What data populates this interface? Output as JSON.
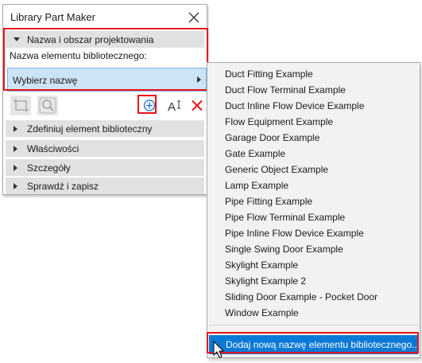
{
  "window": {
    "title": "Library Part Maker"
  },
  "sections": {
    "open": {
      "label": "Nazwa i obszar projektowania"
    },
    "collapsed": [
      {
        "label": "Zdefiniuj element biblioteczny"
      },
      {
        "label": "Właściwości"
      },
      {
        "label": "Szczegóły"
      },
      {
        "label": "Sprawdź i zapisz"
      }
    ]
  },
  "name_field": {
    "label": "Nazwa elementu bibliotecznego:",
    "value": "Wybierz nazwę"
  },
  "toolbar": {
    "buttons": [
      {
        "icon": "crop-frame-icon",
        "enabled": false
      },
      {
        "icon": "zoom-icon",
        "enabled": false
      },
      {
        "icon": "add-circle-icon",
        "enabled": true,
        "highlighted": true
      },
      {
        "icon": "rename-text-icon",
        "enabled": true,
        "text": "A"
      },
      {
        "icon": "delete-x-icon",
        "enabled": true,
        "color": "#e8131b"
      }
    ]
  },
  "dropdown": {
    "items": [
      "Duct Fitting Example",
      "Duct Flow Terminal Example",
      "Duct Inline Flow Device Example",
      "Flow Equipment Example",
      "Garage Door Example",
      "Gate Example",
      "Generic Object Example",
      "Lamp Example",
      "Pipe Fitting Example",
      "Pipe Flow Terminal Example",
      "Pipe Inline Flow Device Example",
      "Single Swing Door Example",
      "Skylight Example",
      "Skylight Example 2",
      "Sliding Door Example - Pocket Door",
      "Window Example"
    ],
    "add_item": "Dodaj nową nazwę elementu bibliotecznego..."
  },
  "colors": {
    "highlight_border": "#e8131b",
    "selection_blue": "#0a79d6",
    "selector_fill": "#cde4f7",
    "section_header": "#e1e1e1"
  }
}
